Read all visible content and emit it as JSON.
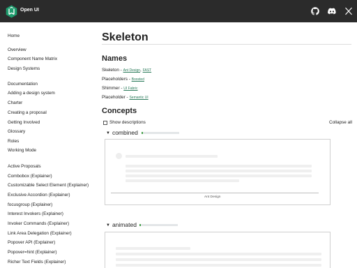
{
  "app": {
    "name": "Open UI"
  },
  "sidebar": {
    "items": [
      {
        "label": "Home"
      },
      {
        "label": "Overview"
      },
      {
        "label": "Component Name Matrix"
      },
      {
        "label": "Design Systems"
      },
      {
        "label": "Documentation"
      },
      {
        "label": "Adding a design system"
      },
      {
        "label": "Charter"
      },
      {
        "label": "Creating a proposal"
      },
      {
        "label": "Getting Involved"
      },
      {
        "label": "Glossary"
      },
      {
        "label": "Roles"
      },
      {
        "label": "Working Mode"
      },
      {
        "label": "Active Proposals"
      },
      {
        "label": "Combobox (Explainer)"
      },
      {
        "label": "Customizable Select Element (Explainer)"
      },
      {
        "label": "Exclusive Accordion (Explainer)"
      },
      {
        "label": "focusgroup (Explainer)"
      },
      {
        "label": "Interest Invokers (Explainer)"
      },
      {
        "label": "Invoker Commands (Explainer)"
      },
      {
        "label": "Link Area Delegation (Explainer)"
      },
      {
        "label": "Popover API (Explainer)"
      },
      {
        "label": "Popover=hint (Explainer)"
      },
      {
        "label": "Richer Text Fields (Explainer)"
      }
    ]
  },
  "page": {
    "title": "Skeleton",
    "names_heading": "Names",
    "names": [
      {
        "name": "Skeleton",
        "sep": " - ",
        "links": [
          "Ant Design",
          "FAST"
        ]
      },
      {
        "name": "Placeholders",
        "sep": " - ",
        "links": [
          "Boosted"
        ]
      },
      {
        "name": "Shimmer",
        "sep": " - ",
        "links": [
          "UI Fabric"
        ]
      },
      {
        "name": "Placeholder",
        "sep": " - ",
        "links": [
          "Semantic UI"
        ]
      }
    ],
    "concepts_heading": "Concepts",
    "show_descriptions_label": "Show descriptions",
    "show_descriptions_checked": false,
    "collapse_all_label": "Collapse all",
    "concepts": [
      {
        "name": "combined",
        "expanded": true,
        "level": 0.04,
        "caption": "Ant Design"
      },
      {
        "name": "animated",
        "expanded": true,
        "level": 0.04
      }
    ]
  },
  "colors": {
    "topbar": "#2b2b2b",
    "link": "#2a7a5a",
    "meter_fill": "#4aa34e",
    "meter_track": "#e3e6e8",
    "logo": "#1f9d6e"
  },
  "icons": [
    "open-ui-logo",
    "github-icon",
    "discord-icon",
    "x-icon",
    "triangle-down-icon"
  ]
}
